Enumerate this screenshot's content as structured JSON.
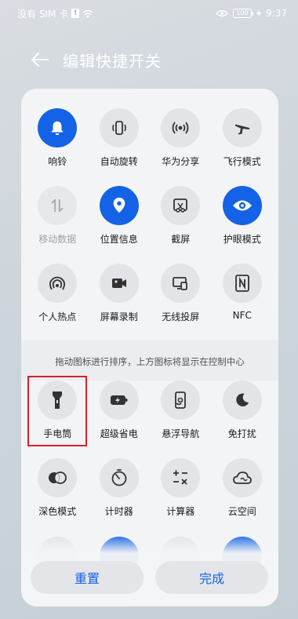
{
  "status": {
    "carrier": "没有 SIM 卡",
    "battery": "100",
    "time": "9:37"
  },
  "header": {
    "title": "编辑快捷开关"
  },
  "top_toggles": [
    {
      "label": "响铃",
      "icon": "bell-icon",
      "active": true
    },
    {
      "label": "自动旋转",
      "icon": "rotate-icon",
      "active": false
    },
    {
      "label": "华为分享",
      "icon": "share-icon",
      "active": false
    },
    {
      "label": "飞行模式",
      "icon": "airplane-icon",
      "active": false
    },
    {
      "label": "移动数据",
      "icon": "mobile-data-icon",
      "active": false,
      "disabled": true
    },
    {
      "label": "位置信息",
      "icon": "location-icon",
      "active": true
    },
    {
      "label": "截屏",
      "icon": "screenshot-icon",
      "active": false
    },
    {
      "label": "护眼模式",
      "icon": "eye-icon",
      "active": true
    },
    {
      "label": "个人热点",
      "icon": "hotspot-icon",
      "active": false
    },
    {
      "label": "屏幕录制",
      "icon": "record-icon",
      "active": false
    },
    {
      "label": "无线投屏",
      "icon": "cast-icon",
      "active": false
    },
    {
      "label": "NFC",
      "icon": "nfc-icon",
      "active": false
    }
  ],
  "hint": "拖动图标进行排序，上方图标将显示在控制中心",
  "bottom_toggles": [
    {
      "label": "手电筒",
      "icon": "flashlight-icon"
    },
    {
      "label": "超级省电",
      "icon": "battery-saver-icon"
    },
    {
      "label": "悬浮导航",
      "icon": "floating-nav-icon"
    },
    {
      "label": "免打扰",
      "icon": "moon-icon"
    },
    {
      "label": "深色模式",
      "icon": "dark-mode-icon"
    },
    {
      "label": "计时器",
      "icon": "timer-icon"
    },
    {
      "label": "计算器",
      "icon": "calculator-icon"
    },
    {
      "label": "云空间",
      "icon": "cloud-icon"
    }
  ],
  "footer": {
    "reset_label": "重置",
    "done_label": "完成"
  },
  "colors": {
    "accent": "#1463e6",
    "highlight": "#d6202c"
  }
}
